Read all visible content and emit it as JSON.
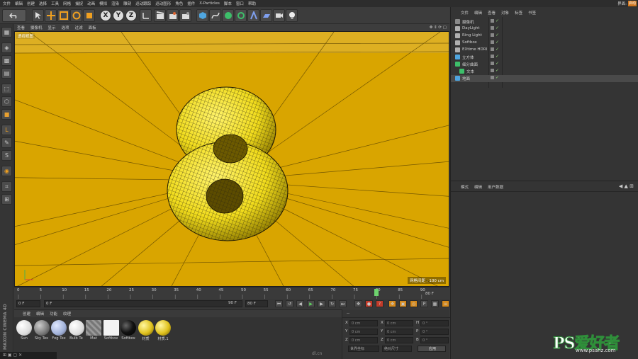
{
  "menubar": {
    "items": [
      "文件",
      "编辑",
      "创建",
      "选择",
      "工具",
      "网格",
      "捕捉",
      "动画",
      "模拟",
      "渲染",
      "雕刻",
      "运动跟踪",
      "运动图形",
      "角色",
      "插件",
      "X-Particles",
      "脚本",
      "窗口",
      "帮助"
    ],
    "layout_label": "界面:",
    "layout_value": "启动"
  },
  "toolbar": {
    "axis_x": "X",
    "axis_y": "Y",
    "axis_z": "Z"
  },
  "viewport": {
    "menu": [
      "查看",
      "摄像机",
      "显示",
      "选项",
      "过滤",
      "面板"
    ],
    "label": "透视视图",
    "grid_label": "网格间距 : 100 cm",
    "bg_color": "#d9a500"
  },
  "timeline": {
    "ticks": [
      "0",
      "5",
      "10",
      "15",
      "20",
      "25",
      "30",
      "35",
      "40",
      "45",
      "50",
      "55",
      "60",
      "65",
      "70",
      "75",
      "80",
      "85",
      "90"
    ],
    "end_label": "80 F",
    "current_frame": 80
  },
  "playbar": {
    "start_field": "0 F",
    "min_field": "0 F",
    "max_field": "90 F",
    "end_field": "80 F"
  },
  "material_manager": {
    "menu": [
      "创建",
      "编辑",
      "功能",
      "纹理"
    ],
    "materials": [
      {
        "name": "Sun",
        "swatch": "white"
      },
      {
        "name": "Sky Tex",
        "swatch": "grey"
      },
      {
        "name": "Fog Tex",
        "swatch": "blue"
      },
      {
        "name": "Bulb Te",
        "swatch": "white"
      },
      {
        "name": "Mat",
        "swatch": "checker"
      },
      {
        "name": "Softbox",
        "swatch": "flat"
      },
      {
        "name": "Softbox",
        "swatch": "black"
      },
      {
        "name": "材质",
        "swatch": "gold"
      },
      {
        "name": "材质.1",
        "swatch": "gold"
      }
    ]
  },
  "coordinates": {
    "header": "--",
    "rows": [
      {
        "a": "X",
        "av": "0 cm",
        "b": "X",
        "bv": "0 cm",
        "c": "H",
        "cv": "0 °"
      },
      {
        "a": "Y",
        "av": "0 cm",
        "b": "Y",
        "bv": "0 cm",
        "c": "P",
        "cv": "0 °"
      },
      {
        "a": "Z",
        "av": "0 cm",
        "b": "Z",
        "bv": "0 cm",
        "c": "B",
        "cv": "0 °"
      }
    ],
    "mode1": "世界坐标",
    "mode2": "绝对尺寸",
    "apply": "应用"
  },
  "object_manager": {
    "menu": [
      "文件",
      "编辑",
      "查看",
      "对象",
      "标签",
      "书签"
    ],
    "objects": [
      {
        "name": "摄像机",
        "color": "#8a8a8a"
      },
      {
        "name": "DayLight",
        "color": "#b0b0b0"
      },
      {
        "name": "Ring Light",
        "color": "#b0b0b0"
      },
      {
        "name": "Softbox",
        "color": "#b0b0b0"
      },
      {
        "name": "EXtime HDRI",
        "color": "#b0b0b0"
      },
      {
        "name": "立方体",
        "color": "#4fa6e0"
      },
      {
        "name": "细分曲面",
        "color": "#3dbf6a"
      },
      {
        "name": "文本",
        "color": "#3dbf6a"
      },
      {
        "name": "地面",
        "color": "#4fa6e0"
      }
    ]
  },
  "attribute_manager": {
    "menu": [
      "模式",
      "编辑",
      "用户数据"
    ]
  },
  "watermark": {
    "brand": "PS爱好者",
    "url": "www.psahz.com"
  },
  "branding": {
    "maxon": "MAXON CINEMA 4D"
  },
  "statusbar": {
    "hint": "dl.cn"
  }
}
